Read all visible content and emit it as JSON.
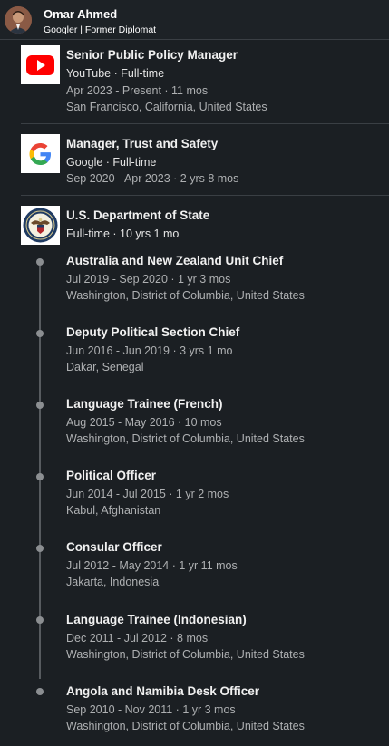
{
  "header": {
    "name": "Omar Ahmed",
    "headline": "Googler | Former Diplomat"
  },
  "experience": [
    {
      "title": "Senior Public Policy Manager",
      "company_type": "YouTube · Full-time",
      "dates": "Apr 2023 - Present · 11 mos",
      "location": "San Francisco, California, United States",
      "logo_icon": "youtube-logo-icon"
    },
    {
      "title": "Manager, Trust and Safety",
      "company_type": "Google · Full-time",
      "dates": "Sep 2020 - Apr 2023 · 2 yrs 8 mos",
      "logo_icon": "google-logo-icon"
    },
    {
      "company": "U.S. Department of State",
      "type_duration": "Full-time · 10 yrs 1 mo",
      "logo_icon": "state-department-seal-icon",
      "roles": [
        {
          "title": "Australia and New Zealand Unit Chief",
          "dates": "Jul 2019 - Sep 2020 · 1 yr 3 mos",
          "location": "Washington, District of Columbia, United States"
        },
        {
          "title": "Deputy Political Section Chief",
          "dates": "Jun 2016 - Jun 2019 · 3 yrs 1 mo",
          "location": "Dakar, Senegal"
        },
        {
          "title": "Language Trainee (French)",
          "dates": "Aug 2015 - May 2016 · 10 mos",
          "location": "Washington, District of Columbia, United States"
        },
        {
          "title": "Political Officer",
          "dates": "Jun 2014 - Jul 2015 · 1 yr 2 mos",
          "location": "Kabul, Afghanistan"
        },
        {
          "title": "Consular Officer",
          "dates": "Jul 2012 - May 2014 · 1 yr 11 mos",
          "location": "Jakarta, Indonesia"
        },
        {
          "title": "Language Trainee (Indonesian)",
          "dates": "Dec 2011 - Jul 2012 · 8 mos",
          "location": "Washington, District of Columbia, United States"
        },
        {
          "title": "Angola and Namibia Desk Officer",
          "dates": "Sep 2010 - Nov 2011 · 1 yr 3 mos",
          "location": "Washington, District of Columbia, United States"
        }
      ]
    }
  ],
  "colors": {
    "background": "#1b1f23",
    "youtube_red": "#ff0000",
    "timeline": "#575b5f"
  }
}
